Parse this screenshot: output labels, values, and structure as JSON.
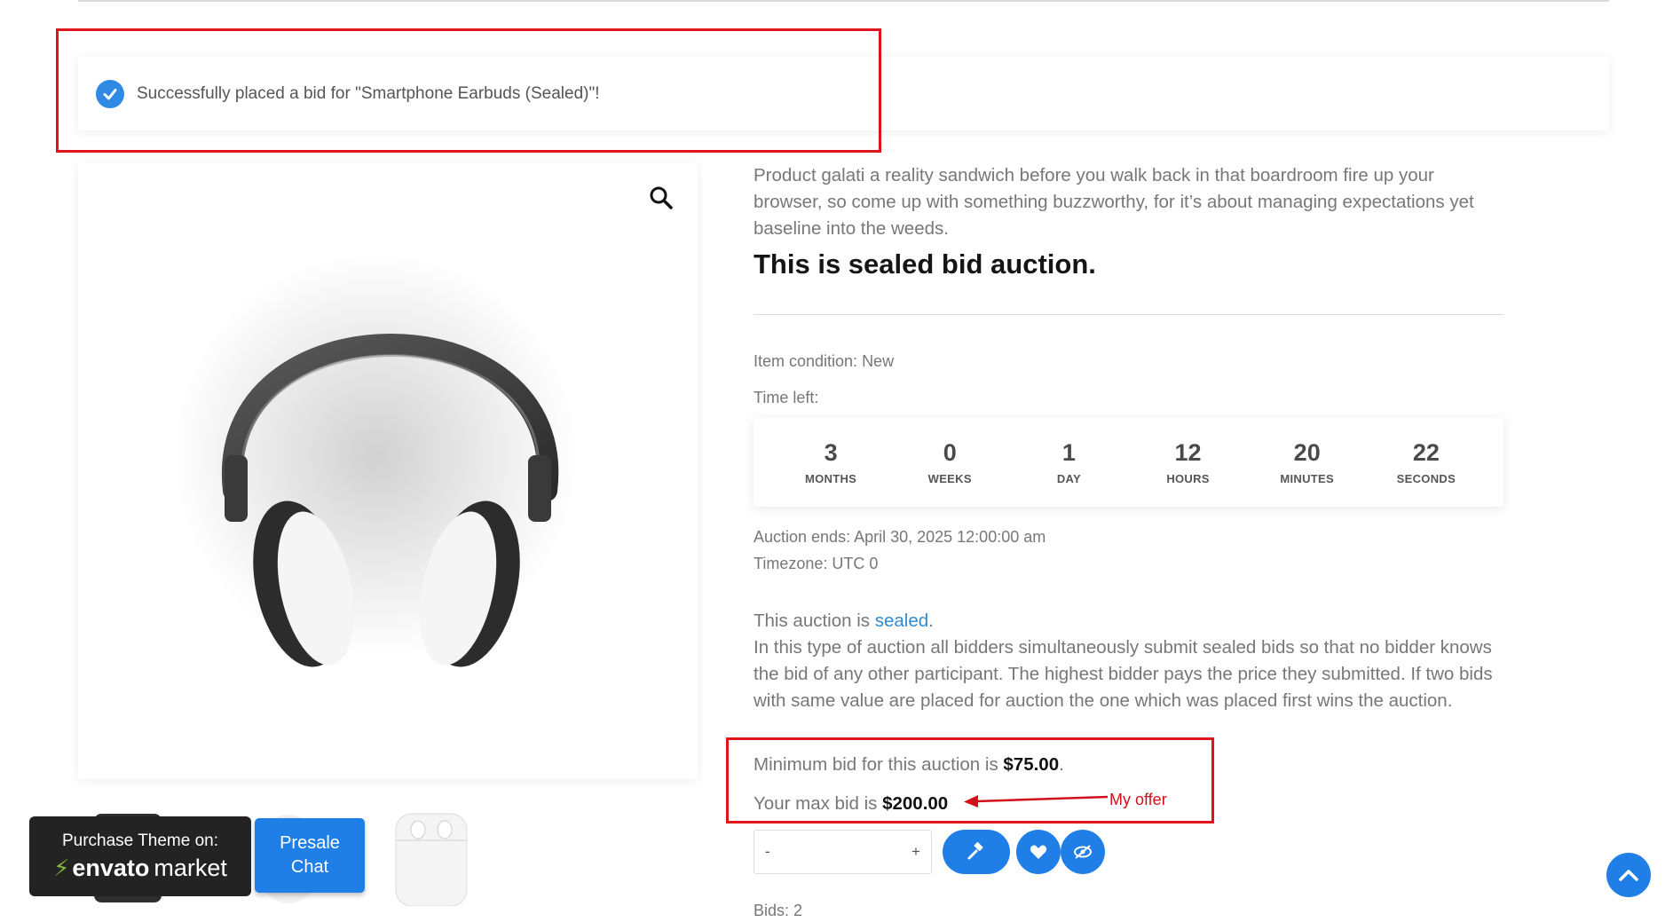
{
  "notice": {
    "message": "Successfully placed a bid for \"Smartphone Earbuds (Sealed)\"!"
  },
  "product": {
    "description": "Product galati a reality sandwich before you walk back in that boardroom fire up your browser, so come up with something buzzworthy, for it’s about managing expectations yet baseline into the weeds.",
    "heading": "This is sealed bid auction.",
    "condition": "Item condition: New",
    "time_left_label": "Time left:"
  },
  "countdown": [
    {
      "value": "3",
      "label": "MONTHS"
    },
    {
      "value": "0",
      "label": "WEEKS"
    },
    {
      "value": "1",
      "label": "DAY"
    },
    {
      "value": "12",
      "label": "HOURS"
    },
    {
      "value": "20",
      "label": "MINUTES"
    },
    {
      "value": "22",
      "label": "SECONDS"
    }
  ],
  "auction": {
    "ends": "Auction ends: April 30, 2025 12:00:00 am",
    "timezone": "Timezone: UTC 0",
    "type_prefix": "This auction is ",
    "type_link": "sealed",
    "type_suffix": ".",
    "explanation": "In this type of auction all bidders simultaneously submit sealed bids so that no bidder knows the bid of any other participant. The highest bidder pays the price they submitted. If two bids with same value are placed for auction the one which was placed first wins the auction.",
    "min_bid_prefix": "Minimum bid for this auction is ",
    "min_bid_value": "$75.00",
    "min_bid_suffix": ".",
    "max_bid_prefix": "Your max bid is ",
    "max_bid_value": "$200.00",
    "bids": "Bids: 2"
  },
  "annotation": {
    "my_offer": "My offer"
  },
  "quantity": {
    "minus": "-",
    "plus": "+",
    "value": ""
  },
  "promo": {
    "purchase_line": "Purchase Theme on:",
    "envato": "envato",
    "market": "market",
    "presale_line1": "Presale",
    "presale_line2": "Chat"
  },
  "colors": {
    "accent": "#1f7fe6",
    "annotation_red": "#e0141c",
    "link": "#2f8ad0"
  }
}
